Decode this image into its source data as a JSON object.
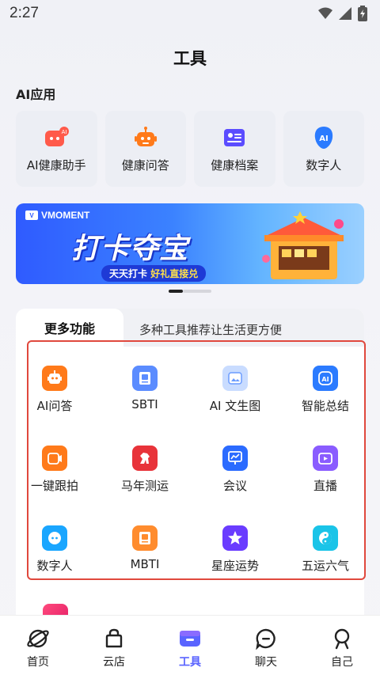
{
  "status": {
    "time": "2:27"
  },
  "header": {
    "title": "工具"
  },
  "ai_section": {
    "title": "AI应用",
    "apps": [
      {
        "label": "AI健康助手",
        "icon": "ai-health-assistant-icon"
      },
      {
        "label": "健康问答",
        "icon": "robot-icon"
      },
      {
        "label": "健康档案",
        "icon": "profile-card-icon"
      },
      {
        "label": "数字人",
        "icon": "digital-human-icon"
      }
    ]
  },
  "banner": {
    "brand": "VMOMENT",
    "headline": "打卡夺宝",
    "sub_left": "天天打卡",
    "sub_right": "好礼直接兑"
  },
  "more": {
    "tab_label": "更多功能",
    "tab_desc": "多种工具推荐让生活更方便",
    "tools": [
      {
        "label": "AI问答",
        "icon": "robot-icon",
        "color": "#ff7a1a"
      },
      {
        "label": "SBTI",
        "icon": "book-icon",
        "color": "#5b8cff"
      },
      {
        "label": "AI 文生图",
        "icon": "image-icon",
        "color": "#9cc2ff"
      },
      {
        "label": "智能总结",
        "icon": "ai-chat-icon",
        "color": "#2b7bff"
      },
      {
        "label": "一键跟拍",
        "icon": "camera-icon",
        "color": "#ff7a1a"
      },
      {
        "label": "马年测运",
        "icon": "horse-icon",
        "color": "#e8333a"
      },
      {
        "label": "会议",
        "icon": "presentation-icon",
        "color": "#2b6bff"
      },
      {
        "label": "直播",
        "icon": "live-icon",
        "color": "#8a5cff"
      },
      {
        "label": "数字人",
        "icon": "digital-human-icon",
        "color": "#1aa6ff"
      },
      {
        "label": "MBTI",
        "icon": "book-icon",
        "color": "#ff8c2e"
      },
      {
        "label": "星座运势",
        "icon": "star-icon",
        "color": "#6a3cff"
      },
      {
        "label": "五运六气",
        "icon": "yin-yang-icon",
        "color": "#1ac4e8"
      }
    ]
  },
  "nav": {
    "items": [
      {
        "label": "首页",
        "icon": "planet-icon"
      },
      {
        "label": "云店",
        "icon": "shopping-bag-icon"
      },
      {
        "label": "工具",
        "icon": "toolbox-icon"
      },
      {
        "label": "聊天",
        "icon": "chat-icon"
      },
      {
        "label": "自己",
        "icon": "person-icon"
      }
    ],
    "active_color": "#5a64ff"
  }
}
